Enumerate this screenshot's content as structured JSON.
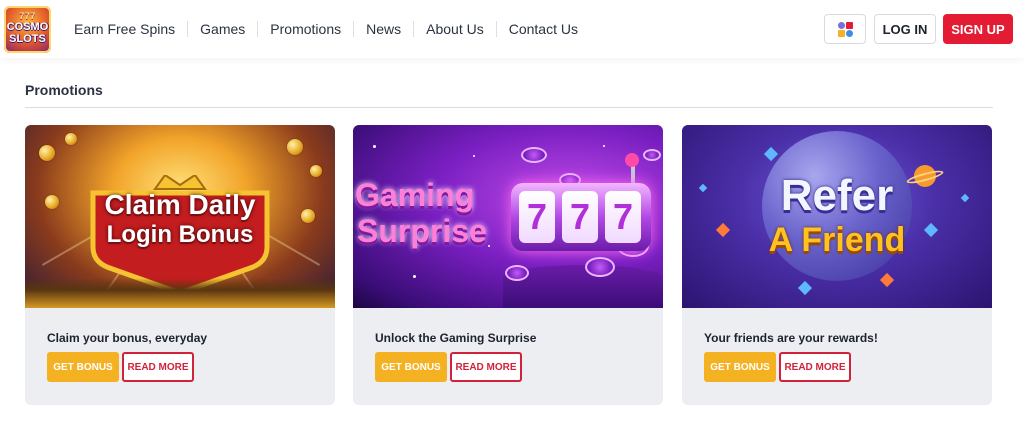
{
  "brand": {
    "logo_lines": [
      "777",
      "COSMO",
      "SLOTS"
    ]
  },
  "nav": {
    "items": [
      "Earn Free Spins",
      "Games",
      "Promotions",
      "News",
      "About Us",
      "Contact Us"
    ]
  },
  "header_actions": {
    "language_icon": "language-switch-icon",
    "login_label": "LOG IN",
    "signup_label": "SIGN UP"
  },
  "section": {
    "title": "Promotions"
  },
  "cards": [
    {
      "banner_line1": "Claim Daily",
      "banner_line2": "Login Bonus",
      "caption": "Claim your bonus, everyday",
      "get_label": "GET BONUS",
      "read_label": "READ MORE"
    },
    {
      "banner_line1": "Gaming",
      "banner_line2": "Surprise",
      "reel_symbols": [
        "7",
        "7",
        "7"
      ],
      "caption": "Unlock the Gaming Surprise",
      "get_label": "GET BONUS",
      "read_label": "READ MORE"
    },
    {
      "banner_line1": "Refer",
      "banner_line2": "A Friend",
      "caption": "Your friends are your rewards!",
      "get_label": "GET BONUS",
      "read_label": "READ MORE"
    }
  ],
  "colors": {
    "accent_red": "#e31c33",
    "bonus_yellow": "#f4b223",
    "card_bg": "#edeef2"
  }
}
